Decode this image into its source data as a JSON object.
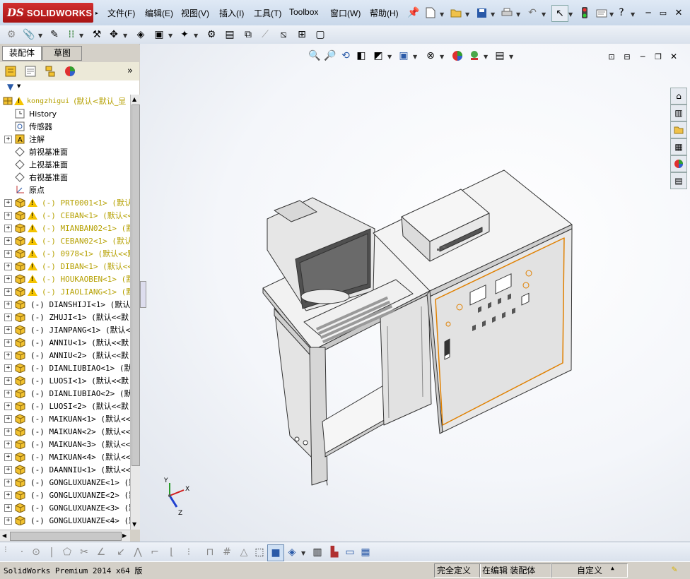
{
  "app": {
    "brand_ds": "DS",
    "brand_name": "SOLIDWORKS"
  },
  "menu": [
    {
      "label": "文件(F)"
    },
    {
      "label": "编辑(E)"
    },
    {
      "label": "视图(V)"
    },
    {
      "label": "插入(I)"
    },
    {
      "label": "工具(T)"
    },
    {
      "label": "Toolbox"
    },
    {
      "label": "窗口(W)"
    },
    {
      "label": "帮助(H)"
    }
  ],
  "panel": {
    "tabs": [
      {
        "label": "装配体"
      },
      {
        "label": "草图"
      }
    ],
    "expand_glyph": "»"
  },
  "tree": {
    "root": {
      "label": "kongzhigui",
      "suffix": "(默认<默认_显"
    },
    "items": [
      {
        "label": "History",
        "icon": "history-icon",
        "expand": false
      },
      {
        "label": "传感器",
        "icon": "sensor-icon",
        "expand": false
      },
      {
        "label": "注解",
        "icon": "annotation-icon",
        "expand": true
      },
      {
        "label": "前视基准面",
        "icon": "plane-icon",
        "expand": false
      },
      {
        "label": "上视基准面",
        "icon": "plane-icon",
        "expand": false
      },
      {
        "label": "右视基准面",
        "icon": "plane-icon",
        "expand": false
      },
      {
        "label": "原点",
        "icon": "origin-icon",
        "expand": false
      }
    ],
    "parts": [
      {
        "label": "(-) PRT0001<1> (默认",
        "warn": true
      },
      {
        "label": "(-) CEBAN<1> (默认<<",
        "warn": true
      },
      {
        "label": "(-) MIANBAN02<1> (默",
        "warn": true
      },
      {
        "label": "(-) CEBAN02<1> (默认",
        "warn": true
      },
      {
        "label": "(-) 0978<1> (默认<<默",
        "warn": true
      },
      {
        "label": "(-) DIBAN<1> (默认<<默",
        "warn": true
      },
      {
        "label": "(-) HOUKAOBEN<1> (默",
        "warn": true
      },
      {
        "label": "(-) JIAOLIANG<1> (默",
        "warn": true
      },
      {
        "label": "(-) DIANSHIJI<1> (默认<",
        "warn": false
      },
      {
        "label": "(-) ZHUJI<1> (默认<<默",
        "warn": false
      },
      {
        "label": "(-) JIANPANG<1> (默认<<",
        "warn": false
      },
      {
        "label": "(-) ANNIU<1> (默认<<默",
        "warn": false
      },
      {
        "label": "(-) ANNIU<2> (默认<<默",
        "warn": false
      },
      {
        "label": "(-) DIANLIUBIAO<1> (默认",
        "warn": false
      },
      {
        "label": "(-) LUOSI<1> (默认<<默",
        "warn": false
      },
      {
        "label": "(-) DIANLIUBIAO<2> (默认",
        "warn": false
      },
      {
        "label": "(-) LUOSI<2> (默认<<默",
        "warn": false
      },
      {
        "label": "(-) MAIKUAN<1> (默认<<默",
        "warn": false
      },
      {
        "label": "(-) MAIKUAN<2> (默认<<默",
        "warn": false
      },
      {
        "label": "(-) MAIKUAN<3> (默认<<默",
        "warn": false
      },
      {
        "label": "(-) MAIKUAN<4> (默认<<默",
        "warn": false
      },
      {
        "label": "(-) DAANNIU<1> (默认<<默",
        "warn": false
      },
      {
        "label": "(-) GONGLUXUANZE<1> (默",
        "warn": false
      },
      {
        "label": "(-) GONGLUXUANZE<2> (默",
        "warn": false
      },
      {
        "label": "(-) GONGLUXUANZE<3> (默",
        "warn": false
      },
      {
        "label": "(-) GONGLUXUANZE<4> (默",
        "warn": false
      }
    ]
  },
  "triad": {
    "x": "X",
    "y": "Y",
    "z": "Z"
  },
  "status": {
    "product": "SolidWorks Premium 2014 x64 版",
    "state": "完全定义",
    "mode": "在编辑 装配体",
    "units": "自定义"
  },
  "colors": {
    "brand": "#c41e1e",
    "warning": "#f5c400",
    "model_edge": "#e08000"
  }
}
